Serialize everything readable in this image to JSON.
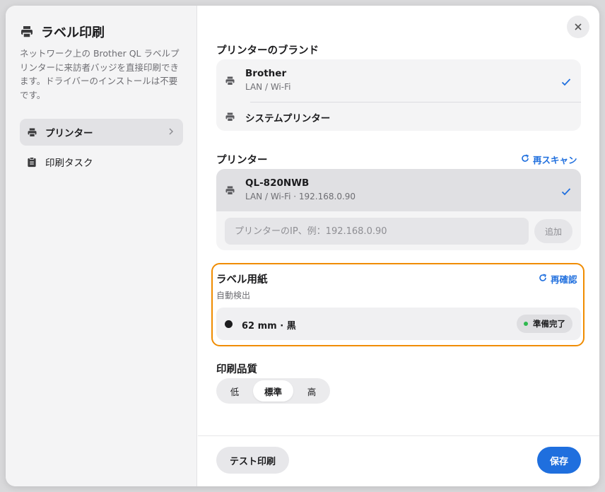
{
  "colors": {
    "accent": "#1f6fde",
    "highlight_border": "#f08c00",
    "ready_dot": "#2fb94f"
  },
  "sidebar": {
    "title": "ラベル印刷",
    "title_icon": "printer-icon",
    "description": "ネットワーク上の Brother QL ラベルプリンターに来訪者バッジを直接印刷できます。ドライバーのインストールは不要です。",
    "items": [
      {
        "label": "プリンター",
        "icon": "printer-icon",
        "active": true
      },
      {
        "label": "印刷タスク",
        "icon": "clipboard-icon",
        "active": false
      }
    ]
  },
  "main": {
    "brand": {
      "label": "プリンターのブランド",
      "options": [
        {
          "title": "Brother",
          "subtitle": "LAN / Wi-Fi",
          "selected": true
        },
        {
          "title": "システムプリンター",
          "selected": false
        }
      ]
    },
    "printer": {
      "label": "プリンター",
      "rescan": "再スキャン",
      "device": {
        "title": "QL-820NWB",
        "subtitle": "LAN / Wi-Fi · 192.168.0.90",
        "selected": true
      },
      "ip_placeholder": "プリンターのIP、例：192.168.0.90",
      "ip_value": "",
      "add": "追加"
    },
    "paper": {
      "label": "ラベル用紙",
      "recheck": "再確認",
      "detect": "自動検出",
      "value": "62 mm · 黒",
      "status": "準備完了"
    },
    "quality": {
      "label": "印刷品質",
      "options": [
        "低",
        "標準",
        "高"
      ],
      "selected": "標準"
    },
    "footer": {
      "test_print": "テスト印刷",
      "save": "保存"
    }
  }
}
